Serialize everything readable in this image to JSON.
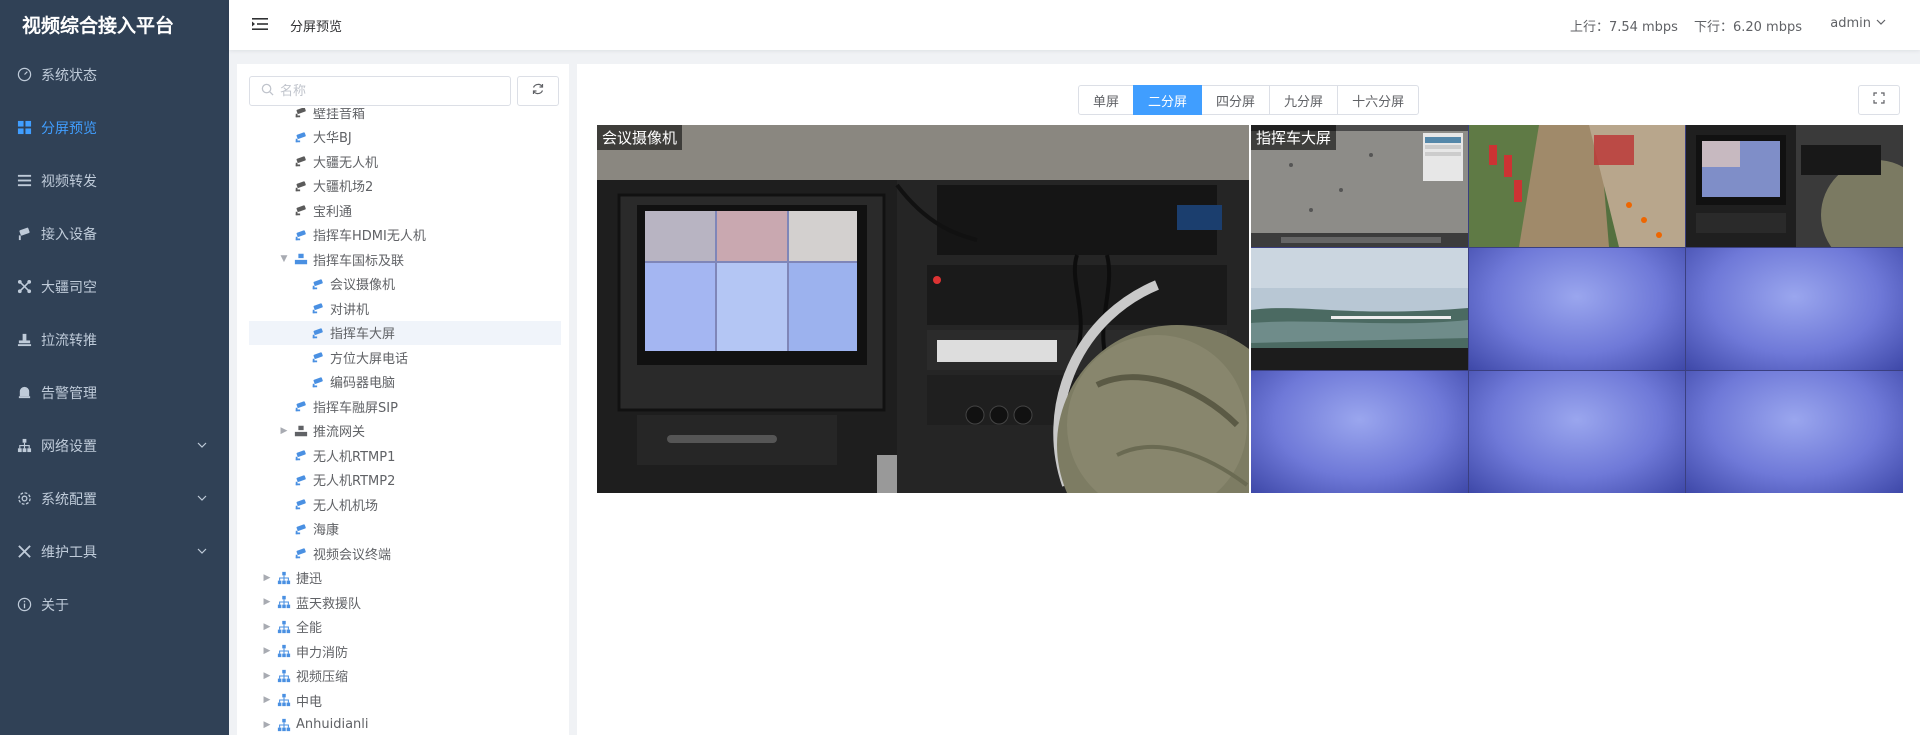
{
  "app": {
    "title": "视频综合接入平台"
  },
  "sidebar": {
    "items": [
      {
        "label": "系统状态",
        "icon": "dashboard-icon",
        "active": false,
        "expandable": false
      },
      {
        "label": "分屏预览",
        "icon": "grid-icon",
        "active": true,
        "expandable": false
      },
      {
        "label": "视频转发",
        "icon": "list-icon",
        "active": false,
        "expandable": false
      },
      {
        "label": "接入设备",
        "icon": "camera-icon",
        "active": false,
        "expandable": false
      },
      {
        "label": "大疆司空",
        "icon": "drone-icon",
        "active": false,
        "expandable": false
      },
      {
        "label": "拉流转推",
        "icon": "stream-icon",
        "active": false,
        "expandable": false
      },
      {
        "label": "告警管理",
        "icon": "bell-icon",
        "active": false,
        "expandable": false
      },
      {
        "label": "网络设置",
        "icon": "network-icon",
        "active": false,
        "expandable": true
      },
      {
        "label": "系统配置",
        "icon": "gear-icon",
        "active": false,
        "expandable": true
      },
      {
        "label": "维护工具",
        "icon": "tools-icon",
        "active": false,
        "expandable": true
      },
      {
        "label": "关于",
        "icon": "info-icon",
        "active": false,
        "expandable": false
      }
    ]
  },
  "header": {
    "breadcrumb": "分屏预览",
    "upload": "上行：7.54 mbps",
    "download": "下行：6.20 mbps",
    "user": "admin"
  },
  "tree": {
    "search_placeholder": "名称",
    "nodes": [
      {
        "label": "壁挂音箱",
        "level": 2,
        "type": "camera-offline",
        "caret": ""
      },
      {
        "label": "大华BJ",
        "level": 2,
        "type": "camera",
        "caret": ""
      },
      {
        "label": "大疆无人机",
        "level": 2,
        "type": "camera-offline",
        "caret": ""
      },
      {
        "label": "大疆机场2",
        "level": 2,
        "type": "camera-offline",
        "caret": ""
      },
      {
        "label": "宝利通",
        "level": 2,
        "type": "camera-offline",
        "caret": ""
      },
      {
        "label": "指挥车HDMI无人机",
        "level": 2,
        "type": "camera",
        "caret": ""
      },
      {
        "label": "指挥车国标及联",
        "level": 2,
        "type": "group",
        "caret": "▼"
      },
      {
        "label": "会议摄像机",
        "level": 3,
        "type": "camera",
        "caret": ""
      },
      {
        "label": "对讲机",
        "level": 3,
        "type": "camera",
        "caret": ""
      },
      {
        "label": "指挥车大屏",
        "level": 3,
        "type": "camera",
        "caret": "",
        "selected": true
      },
      {
        "label": "方位大屏电话",
        "level": 3,
        "type": "camera",
        "caret": ""
      },
      {
        "label": "编码器电脑",
        "level": 3,
        "type": "camera",
        "caret": ""
      },
      {
        "label": "指挥车融屏SIP",
        "level": 2,
        "type": "camera",
        "caret": ""
      },
      {
        "label": "推流网关",
        "level": 2,
        "type": "group-dark",
        "caret": "▶"
      },
      {
        "label": "无人机RTMP1",
        "level": 2,
        "type": "camera",
        "caret": ""
      },
      {
        "label": "无人机RTMP2",
        "level": 2,
        "type": "camera",
        "caret": ""
      },
      {
        "label": "无人机机场",
        "level": 2,
        "type": "camera",
        "caret": ""
      },
      {
        "label": "海康",
        "level": 2,
        "type": "camera",
        "caret": ""
      },
      {
        "label": "视频会议终端",
        "level": 2,
        "type": "camera",
        "caret": ""
      },
      {
        "label": "捷迅",
        "level": 1,
        "type": "org",
        "caret": "▶"
      },
      {
        "label": "蓝天救援队",
        "level": 1,
        "type": "org",
        "caret": "▶"
      },
      {
        "label": "全能",
        "level": 1,
        "type": "org",
        "caret": "▶"
      },
      {
        "label": "申力消防",
        "level": 1,
        "type": "org",
        "caret": "▶"
      },
      {
        "label": "视频压缩",
        "level": 1,
        "type": "org",
        "caret": "▶"
      },
      {
        "label": "中电",
        "level": 1,
        "type": "org",
        "caret": "▶"
      },
      {
        "label": "Anhuidianli",
        "level": 1,
        "type": "org",
        "caret": "▶"
      }
    ]
  },
  "modes": [
    {
      "label": "单屏",
      "active": false
    },
    {
      "label": "二分屏",
      "active": true
    },
    {
      "label": "四分屏",
      "active": false
    },
    {
      "label": "九分屏",
      "active": false
    },
    {
      "label": "十六分屏",
      "active": false
    }
  ],
  "screens": {
    "left_label": "会议摄像机",
    "right_label": "指挥车大屏"
  },
  "colors": {
    "sidebar_bg": "#304156",
    "accent": "#409eff",
    "tree_icon": "#4a90e2"
  }
}
